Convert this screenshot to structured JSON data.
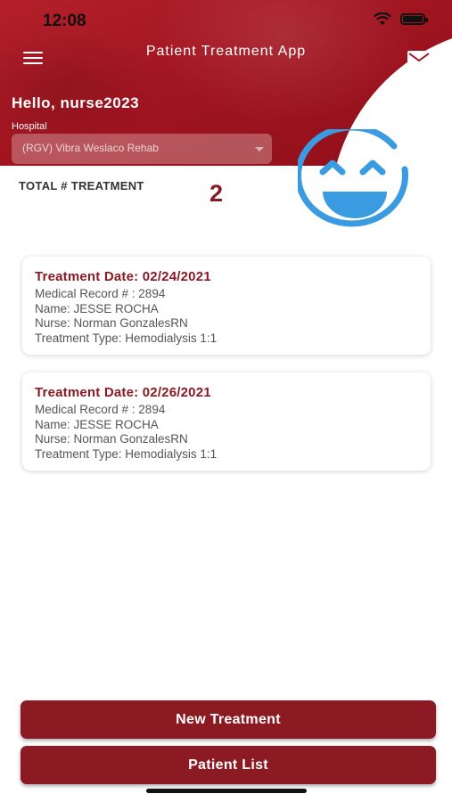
{
  "status_bar": {
    "time": "12:08"
  },
  "header": {
    "app_title": "Patient Treatment App",
    "greeting": "Hello, nurse2023",
    "hospital_label": "Hospital",
    "hospital_value": "(RGV) Vibra Weslaco Rehab"
  },
  "summary": {
    "total_label": "TOTAL # TREATMENT",
    "total_count": "2"
  },
  "treatments": [
    {
      "date": "Treatment Date: 02/24/2021",
      "record": "Medical Record # : 2894",
      "name": "Name: JESSE ROCHA",
      "nurse": "Nurse: Norman GonzalesRN",
      "type": "Treatment Type: Hemodialysis 1:1"
    },
    {
      "date": "Treatment Date: 02/26/2021",
      "record": "Medical Record # : 2894",
      "name": "Name: JESSE ROCHA",
      "nurse": "Nurse: Norman GonzalesRN",
      "type": "Treatment Type: Hemodialysis 1:1"
    }
  ],
  "buttons": {
    "new_treatment": "New Treatment",
    "patient_list": "Patient List"
  },
  "colors": {
    "brand_red": "#8b1a22",
    "smiley_blue": "#3a9be0"
  },
  "icons": [
    "menu-icon",
    "mail-icon",
    "wifi-icon",
    "battery-icon",
    "smiley-icon",
    "caret-down-icon"
  ]
}
